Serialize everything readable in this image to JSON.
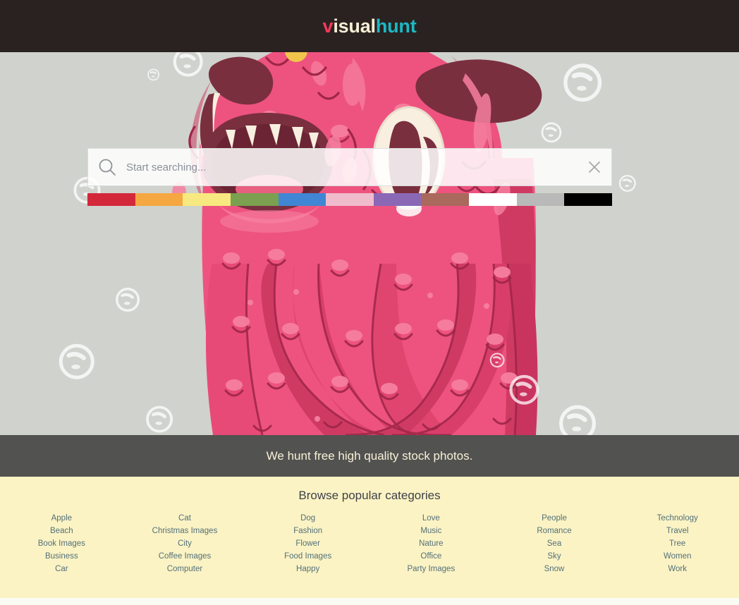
{
  "header": {
    "logo": {
      "part1": "v",
      "part2": "isual",
      "part3": "hunt"
    },
    "logo_colors": {
      "v": "#f4395b",
      "isual": "#f6edd6",
      "hunt": "#1bb9c4"
    },
    "background": "#2a2220"
  },
  "hero": {
    "background": "#d0d2cd",
    "illustration": "pink-monster-illustration"
  },
  "search": {
    "placeholder": "Start searching...",
    "value": "",
    "icon": "search-icon",
    "clear_icon": "close-icon"
  },
  "swatches": [
    {
      "name": "red",
      "hex": "#d32839"
    },
    {
      "name": "orange",
      "hex": "#f5a742"
    },
    {
      "name": "yellow",
      "hex": "#f7e97f"
    },
    {
      "name": "green",
      "hex": "#7ba04f"
    },
    {
      "name": "blue",
      "hex": "#4186d4"
    },
    {
      "name": "pink",
      "hex": "#f0bccb"
    },
    {
      "name": "purple",
      "hex": "#8a68b6"
    },
    {
      "name": "brown",
      "hex": "#a9695c"
    },
    {
      "name": "white",
      "hex": "#ffffff"
    },
    {
      "name": "gray",
      "hex": "#b9b9b9"
    },
    {
      "name": "black",
      "hex": "#000000"
    }
  ],
  "tagline": {
    "text": "We hunt free high quality stock photos.",
    "background": "#525250",
    "color": "#f8f1d8"
  },
  "categories": {
    "title": "Browse popular categories",
    "background": "#fbf3c4",
    "link_color": "#53707a",
    "columns": [
      [
        "Apple",
        "Beach",
        "Book Images",
        "Business",
        "Car"
      ],
      [
        "Cat",
        "Christmas Images",
        "City",
        "Coffee Images",
        "Computer"
      ],
      [
        "Dog",
        "Fashion",
        "Flower",
        "Food Images",
        "Happy"
      ],
      [
        "Love",
        "Music",
        "Nature",
        "Office",
        "Party Images"
      ],
      [
        "People",
        "Romance",
        "Sea",
        "Sky",
        "Snow"
      ],
      [
        "Technology",
        "Travel",
        "Tree",
        "Women",
        "Work"
      ]
    ]
  }
}
